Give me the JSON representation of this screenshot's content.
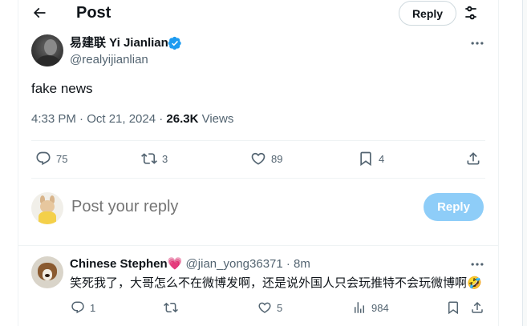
{
  "header": {
    "title": "Post",
    "reply_button": "Reply"
  },
  "tweet": {
    "author_name": "易建联 Yi Jianlian",
    "author_handle": "@realyijianlian",
    "text": "fake news",
    "time": "4:33 PM · Oct 21, 2024 · ",
    "views_count": "26.3K",
    "views_label": " Views",
    "stats": {
      "replies": "75",
      "reposts": "3",
      "likes": "89",
      "bookmarks": "4"
    }
  },
  "composer": {
    "placeholder": "Post your reply",
    "button": "Reply"
  },
  "comment": {
    "author_name": "Chinese Stephen",
    "heart": "💗",
    "handle_time": " @jian_yong36371 · 8m",
    "text": "笑死我了，大哥怎么不在微博发啊，还是说外国人只会玩推特不会玩微博啊🤣",
    "stats": {
      "replies": "1",
      "reposts": "",
      "likes": "5",
      "views": "984"
    }
  },
  "colors": {
    "accent": "#1d9bf0",
    "reply_button_disabled": "#8ecdf8",
    "secondary_text": "#536471",
    "divider": "#eff3f4"
  }
}
